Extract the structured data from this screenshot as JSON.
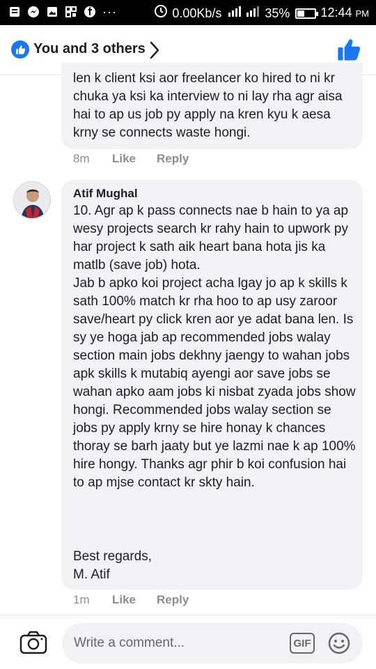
{
  "status_bar": {
    "network_speed": "0.00Kb/s",
    "network_type": "4G",
    "battery_percent": "35%",
    "battery_level": 0.35,
    "time": "12:44",
    "time_suffix": "PM",
    "icons": [
      "notification-icon",
      "messenger-icon",
      "image-icon",
      "qr-icon",
      "facebook-icon",
      "more-dots-icon",
      "data-saver-icon",
      "signal-icon",
      "battery-icon"
    ]
  },
  "header": {
    "reaction_summary": "You and 3 others",
    "accent_color": "#1877f2"
  },
  "comments": [
    {
      "text": "len k client ksi aor freelancer ko hired to ni kr chuka ya ksi ka interview to ni lay rha agr aisa hai to ap us job py apply na kren kyu k aesa krny se connects waste hongi.",
      "time": "8m",
      "like_label": "Like",
      "reply_label": "Reply"
    },
    {
      "author": "Atif Mughal",
      "text": "10. Agr ap k pass connects nae b hain to ya ap wesy projects search kr rahy hain to upwork py har project k sath aik heart bana hota jis ka matlb (save job) hota.\nJab b apko koi project acha lgay jo ap k skills k sath 100% match kr rha hoo to ap usy zaroor save/heart py click kren aor ye adat bana len. Is sy ye hoga jab ap recommended jobs walay section main jobs dekhny jaengy to wahan jobs apk skills k mutabiq ayengi aor save jobs se wahan apko aam jobs ki nisbat zyada jobs show hongi. Recommended jobs walay section se jobs py apply krny se hire honay k chances thoray se barh jaaty but ye lazmi nae k ap 100% hire hongy. Thanks agr phir b koi confusion hai to ap mjse contact kr skty hain.",
      "signature": "Best regards,\nM. Atif",
      "time": "1m",
      "like_label": "Like",
      "reply_label": "Reply"
    }
  ],
  "composer": {
    "placeholder": "Write a comment...",
    "gif_label": "GIF"
  }
}
